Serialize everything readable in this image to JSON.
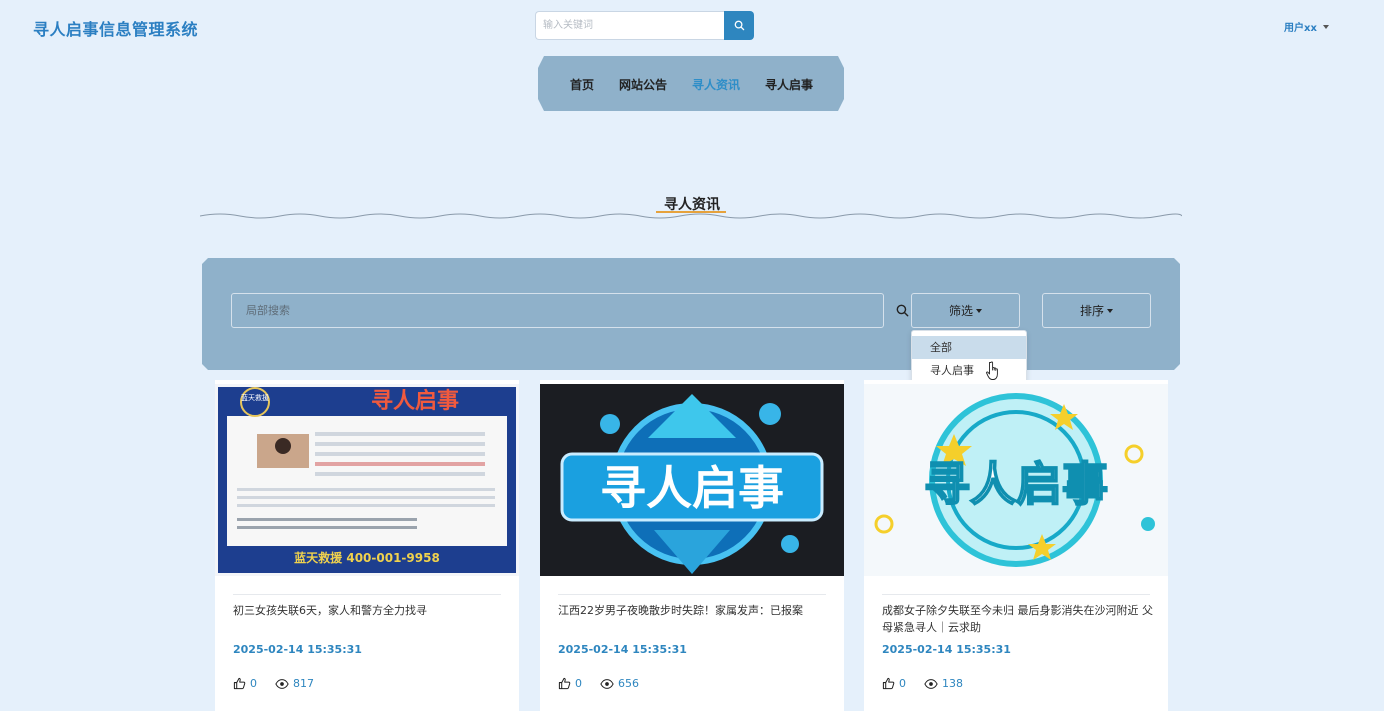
{
  "header": {
    "brand": "寻人启事信息管理系统",
    "search_placeholder": "输入关键词",
    "user_label": "用户xx"
  },
  "nav": {
    "items": [
      {
        "label": "首页"
      },
      {
        "label": "网站公告"
      },
      {
        "label": "寻人资讯",
        "active": true
      },
      {
        "label": "寻人启事"
      }
    ]
  },
  "section": {
    "title": "寻人资讯"
  },
  "filter": {
    "local_search_placeholder": "局部搜索",
    "filter_label": "筛选",
    "sort_label": "排序",
    "dropdown_options": [
      "全部",
      "寻人启事"
    ],
    "hovered_option": "全部"
  },
  "cards": [
    {
      "title": "初三女孩失联6天，家人和警方全力找寻",
      "date": "2025-02-14 15:35:31",
      "likes": "0",
      "views": "817",
      "poster": {
        "banner": "寻人启事",
        "badge": "蓝天救援",
        "hotline": "蓝天救援 400-001-9958"
      }
    },
    {
      "title": "江西22岁男子夜晚散步时失踪！家属发声：已报案",
      "date": "2025-02-14 15:35:31",
      "likes": "0",
      "views": "656",
      "poster": {
        "banner": "寻人启事"
      }
    },
    {
      "title": "成都女子除夕失联至今未归 最后身影消失在沙河附近 父母紧急寻人｜云求助",
      "date": "2025-02-14 15:35:31",
      "likes": "0",
      "views": "138",
      "poster": {
        "banner": "寻人启事"
      }
    }
  ],
  "colors": {
    "page_bg": "#e5f0fb",
    "panel_bg": "#8fb1ca",
    "accent": "#2e86bf",
    "brand": "#2b7fc2"
  }
}
